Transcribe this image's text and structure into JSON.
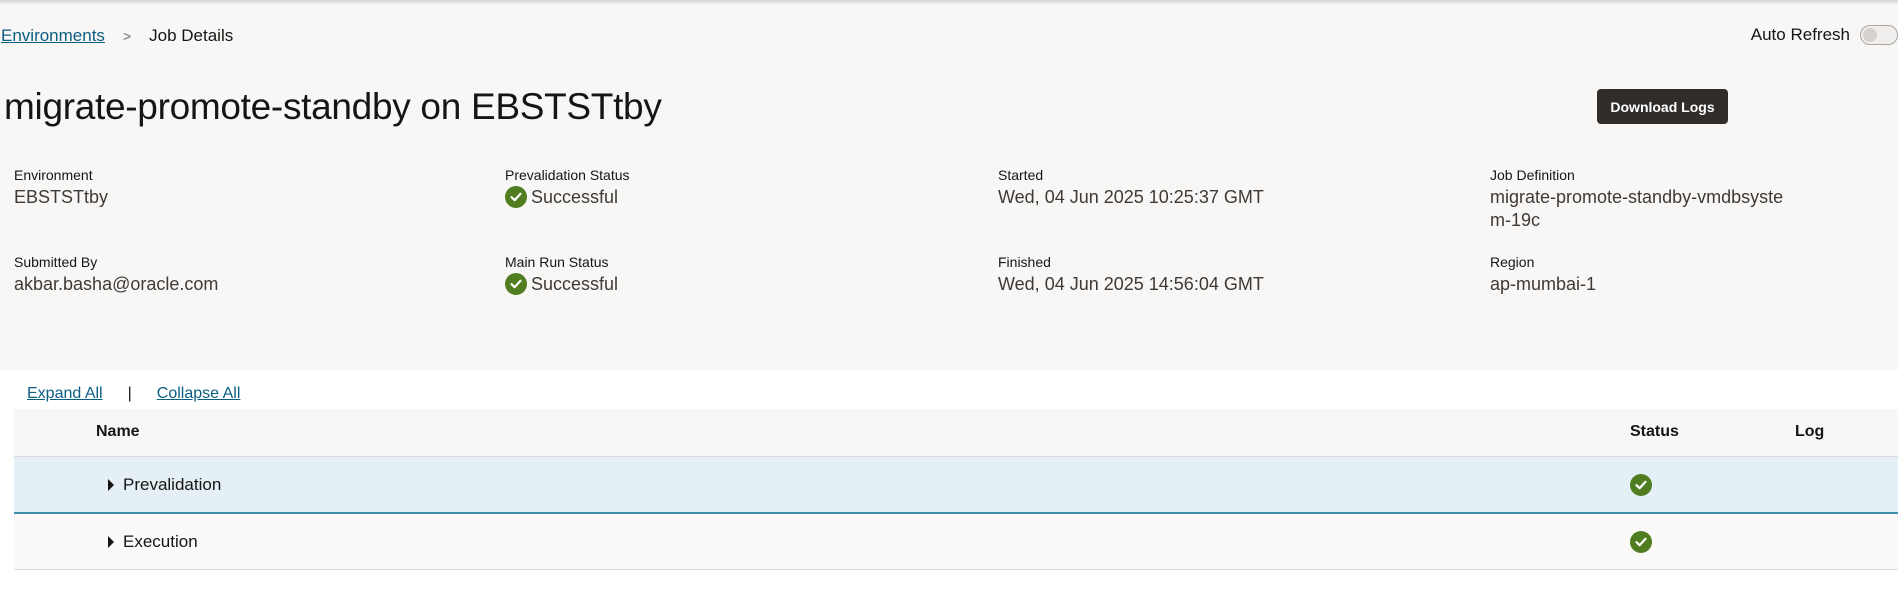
{
  "breadcrumb": {
    "root": "Environments",
    "separator": ">",
    "current": "Job Details"
  },
  "auto_refresh": {
    "label": "Auto Refresh",
    "enabled": false
  },
  "title": "migrate-promote-standby on EBSTSTtby",
  "download_button": "Download Logs",
  "details": {
    "environment": {
      "label": "Environment",
      "value": "EBSTSTtby"
    },
    "prevalidation_status": {
      "label": "Prevalidation Status",
      "value": "Successful",
      "icon": "check-circle-icon"
    },
    "started": {
      "label": "Started",
      "value": "Wed, 04 Jun 2025 10:25:37 GMT"
    },
    "job_definition": {
      "label": "Job Definition",
      "value_line1": "migrate-promote-standby-vmdbsyste",
      "value_line2": "m-19c"
    },
    "submitted_by": {
      "label": "Submitted By",
      "value": "akbar.basha@oracle.com"
    },
    "main_run_status": {
      "label": "Main Run Status",
      "value": "Successful",
      "icon": "check-circle-icon"
    },
    "finished": {
      "label": "Finished",
      "value": "Wed, 04 Jun 2025 14:56:04 GMT"
    },
    "region": {
      "label": "Region",
      "value": "ap-mumbai-1"
    }
  },
  "tree_controls": {
    "expand_all": "Expand All",
    "separator": "|",
    "collapse_all": "Collapse All"
  },
  "table": {
    "columns": [
      "Name",
      "Status",
      "Log"
    ],
    "rows": [
      {
        "name": "Prevalidation",
        "status": "success",
        "selected": true
      },
      {
        "name": "Execution",
        "status": "success",
        "selected": false
      }
    ]
  },
  "colors": {
    "success": "#4f7d1f",
    "link": "#0b5d82",
    "button_bg": "#312d2a",
    "selected_row": "#e4f0f5"
  }
}
